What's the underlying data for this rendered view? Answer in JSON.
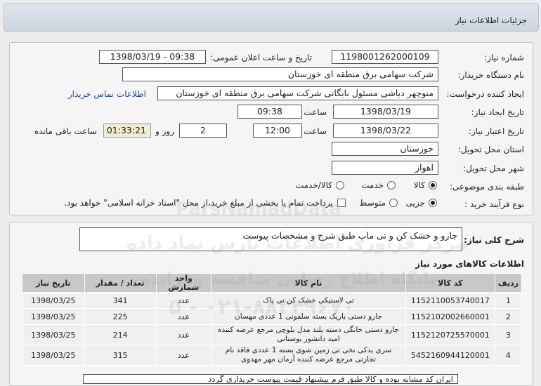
{
  "header": {
    "title": "جزئیات اطلاعات نیاز"
  },
  "fields": {
    "need_number_label": "شماره نیاز:",
    "need_number": "1198001262000109",
    "announce_label": "تاریخ و ساعت اعلان عمومی:",
    "announce_value": "1398/03/19 - 09:38",
    "buyer_label": "نام دستگاه خریدار:",
    "buyer_value": "شرکت سهامی برق منطقه ای خوزستان",
    "creator_label": "ایجاد کننده درخواست:",
    "creator_value": "منوچهر دباشی مسئول بایگانی شرکت سهامی برق منطقه ای خوزستان",
    "contact_link": "اطلاعات تماس خریدار",
    "create_date_label": "تاریخ ایجاد نیاز:",
    "create_date": "1398/03/19",
    "time_label": "ساعت",
    "create_time": "09:38",
    "validity_label": "تاریخ اعتبار نیاز:",
    "validity_date": "1398/03/22",
    "validity_time": "12:00",
    "days_count": "2",
    "days_label": "روز و",
    "remaining_time": "01:33:21",
    "remaining_label": "ساعت باقی مانده",
    "province_label": "استان محل تحویل:",
    "province_value": "خوزستان",
    "city_label": "شهر محل تحویل:",
    "city_value": "اهواز",
    "category_label": "طبقه بندی موضوعی:",
    "category_options": [
      "کالا",
      "خدمت",
      "کالا/خدمت"
    ],
    "process_label": "نوع فرآیند خرید :",
    "process_options": [
      "جزیی",
      "متوسط"
    ],
    "payment_note": "پرداخت تمام یا بخشی از مبلغ خرید،از محل \"اسناد خزانه اسلامی\" خواهد بود."
  },
  "summary": {
    "label": "شرح کلی نیاز:",
    "value": "جارو و خشک کن و تی ماپ  طبق شرح و مشخصات پیوست"
  },
  "items_section": {
    "title": "اطلاعات کالاهای مورد نیاز",
    "columns": [
      "ردیف",
      "کد کالا",
      "نام کالا",
      "واحد شمارش",
      "تعداد / مقدار",
      "تاریخ نیاز"
    ],
    "rows": [
      [
        "1",
        "1152110053740017",
        "تی لاستیکی خشک کن تی پاک",
        "عدد",
        "341",
        "1398/03/25"
      ],
      [
        "2",
        "1152102002660001",
        "جارو دستی باریک بسته سلفونی 1 عددی مهسان",
        "عدد",
        "225",
        "1398/03/25"
      ],
      [
        "3",
        "1152120725570001",
        "جارو دستی خانگی دسته بلند مدل بلوچی مرجع عرضه کننده امید دانشور بوستانی",
        "عدد",
        "214",
        "1398/03/25"
      ],
      [
        "4",
        "5452160944120001",
        "سری یدکی نخی تی زمین شوی بسته 1 عددی فاقد نام تجارتی مرجع عرضه کننده آرمان مهر مهدوی",
        "عدد",
        "315",
        "1398/03/25"
      ]
    ]
  },
  "bottom_note": "ایران کد مشابه بوده و کالا طبق فرم پیشنهاد قیمت پیوست خریداری گردد",
  "watermark": {
    "line1": "ParsNamadData",
    "line2": "مرکز فراوری اطلاعات پارس نماد داده",
    "line3": "پایگاه اطلاع رسانی مناقصه ومزایده",
    "line4": "۰۲۱-۸۸۳۴۹۶۷۰ - ۵"
  },
  "colors": {
    "header_bg": "#cdd6e0",
    "table_header": "#c8c8c8",
    "link": "#1f4e9c"
  }
}
